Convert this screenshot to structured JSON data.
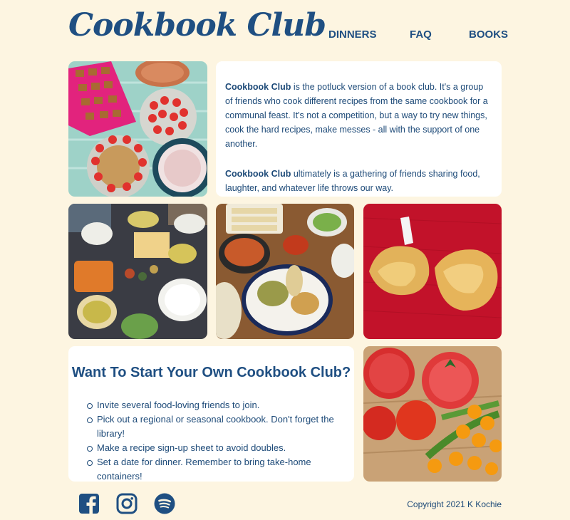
{
  "header": {
    "logo": "Cookbook Club",
    "nav": [
      "DINNERS",
      "FAQ",
      "BOOKS"
    ]
  },
  "intro": {
    "p1_bold": "Cookbook Club",
    "p1_text": " is the potluck version of a book club. It's a group of friends who cook different recipes from the same cookbook for a communal feast. It's not a competition, but a way to try new things, cook the hard recipes, make messes - all with the support of one another.",
    "p2_bold": "Cookbook Club",
    "p2_text": " ultimately is a gathering of friends sharing food, laughter, and whatever life throws our way."
  },
  "start": {
    "title": "Want To Start Your Own Cookbook Club?",
    "steps": [
      "Invite several food-loving friends to join.",
      "Pick out a regional or seasonal cookbook. Don't forget the library!",
      "Make a recipe sign-up sheet to avoid doubles.",
      "Set a date for dinner. Remember to bring take-home containers!"
    ]
  },
  "footer": {
    "social": [
      "facebook-icon",
      "instagram-icon",
      "spotify-icon"
    ],
    "copyright": "Copyright 2021 K Kochie"
  },
  "colors": {
    "background": "#fdf5e1",
    "primary": "#1f4f82",
    "card": "#ffffff"
  }
}
